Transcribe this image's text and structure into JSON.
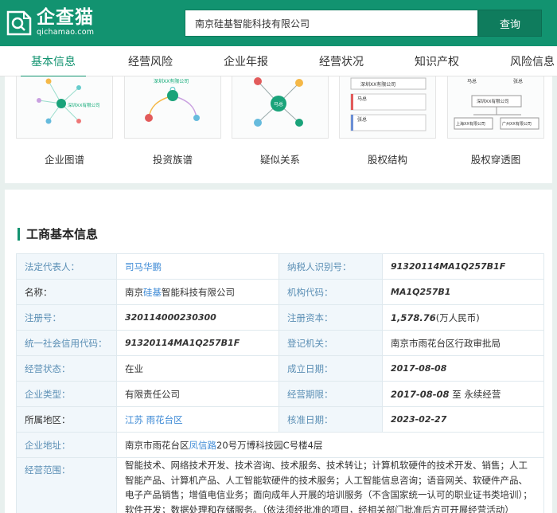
{
  "header": {
    "logo_cn": "企查猫",
    "logo_en": "qichamao.com",
    "search_value": "南京硅基智能科技有限公司",
    "search_button": "查询"
  },
  "tabs": [
    {
      "label": "基本信息",
      "active": true
    },
    {
      "label": "经营风险"
    },
    {
      "label": "企业年报"
    },
    {
      "label": "经营状况"
    },
    {
      "label": "知识产权"
    },
    {
      "label": "风险信息"
    }
  ],
  "graphs": {
    "labels": [
      "企业图谱",
      "投资族谱",
      "疑似关系",
      "股权结构",
      "股权穿透图"
    ],
    "thumb_texts": {
      "company": "深圳XX有限公司",
      "person": "马总",
      "person2": "张总",
      "sh_company": "上海XX有限公司",
      "gz_company": "广州XX有限公司"
    }
  },
  "section_title": "工商基本信息",
  "info": {
    "legal_rep_label": "法定代表人：",
    "legal_rep_value": "司马华鹏",
    "tax_id_label": "纳税人识别号：",
    "tax_id_value": "91320114MA1Q257B1F",
    "name_label": "名称：",
    "name_pre": "南京",
    "name_hl": "硅基",
    "name_post": "智能科技有限公司",
    "org_code_label": "机构代码：",
    "org_code_value": "MA1Q257B1",
    "reg_no_label": "注册号：",
    "reg_no_value": "320114000230300",
    "capital_label": "注册资本：",
    "capital_num": "1,578.76",
    "capital_unit": "(万人民币)",
    "credit_code_label": "统一社会信用代码：",
    "credit_code_value": "91320114MA1Q257B1F",
    "authority_label": "登记机关：",
    "authority_value": "南京市雨花台区行政审批局",
    "status_label": "经营状态：",
    "status_value": "在业",
    "founded_label": "成立日期：",
    "founded_value": "2017-08-08",
    "type_label": "企业类型：",
    "type_value": "有限责任公司",
    "term_label": "经营期限：",
    "term_start": "2017-08-08",
    "term_rest": " 至 永续经营",
    "region_label": "所属地区：",
    "region_value": "江苏 雨花台区",
    "approval_label": "核准日期：",
    "approval_value": "2023-02-27",
    "address_label": "企业地址：",
    "address_pre": "南京市雨花台区",
    "address_hl": "凤信路",
    "address_post": "20号万博科技园C号楼4层",
    "scope_label": "经营范围：",
    "scope_value": "智能技术、网络技术开发、技术咨询、技术服务、技术转让；计算机软硬件的技术开发、销售；人工智能产品、计算机产品、人工智能软硬件的技术服务；人工智能信息咨询；语音网关、软硬件产品、电子产品销售；增值电信业务；面向成年人开展的培训服务（不含国家统一认可的职业证书类培训）；软件开发；数据处理和存储服务。（依法须经批准的项目，经相关部门批准后方可开展经营活动）"
  },
  "colors": {
    "brand": "#129370",
    "label_blue": "#5b8fb5",
    "link_blue": "#3f8bd6"
  }
}
